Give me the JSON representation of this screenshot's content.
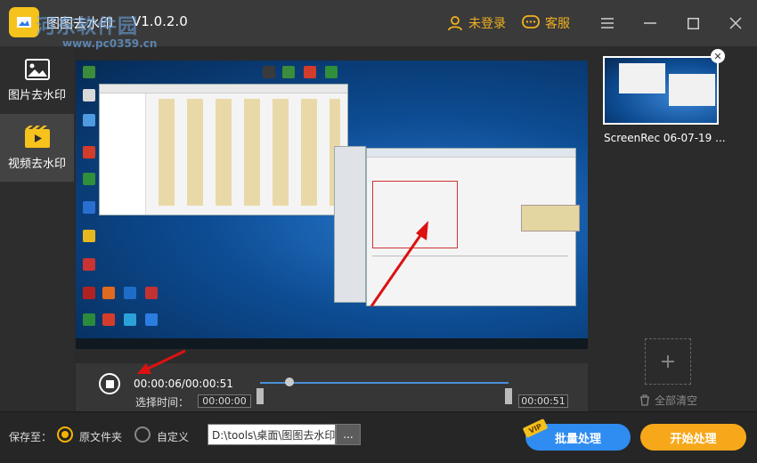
{
  "app": {
    "title": "图图去水印",
    "version": "V1.0.2.0",
    "watermark": "河东软件园",
    "watermark_url": "www.pc0359.cn"
  },
  "titlebar": {
    "login_label": "未登录",
    "service_label": "客服"
  },
  "sidebar": {
    "items": [
      {
        "label": "图片去水印",
        "icon": "image-icon"
      },
      {
        "label": "视频去水印",
        "icon": "video-icon"
      }
    ]
  },
  "player": {
    "current_time": "00:00:06/00:00:51",
    "select_time_label": "选择时间：",
    "start_time": "00:00:00",
    "end_time": "00:00:51",
    "progress_fraction": 0.12
  },
  "file_list": {
    "items": [
      {
        "name": "ScreenRec 06-07-19 ..."
      }
    ],
    "clear_all_label": "全部清空"
  },
  "output": {
    "save_to_label": "保存至：",
    "option_original": "原文件夹",
    "option_custom": "自定义",
    "path": "D:\\tools\\桌面\\图图去水印",
    "browse_label": "..."
  },
  "actions": {
    "vip_badge": "VIP",
    "batch_label": "批量处理",
    "start_label": "开始处理"
  },
  "colors": {
    "accent_orange": "#f7a81a",
    "accent_blue": "#2f8cf0",
    "sidebar_active": "#434343"
  }
}
